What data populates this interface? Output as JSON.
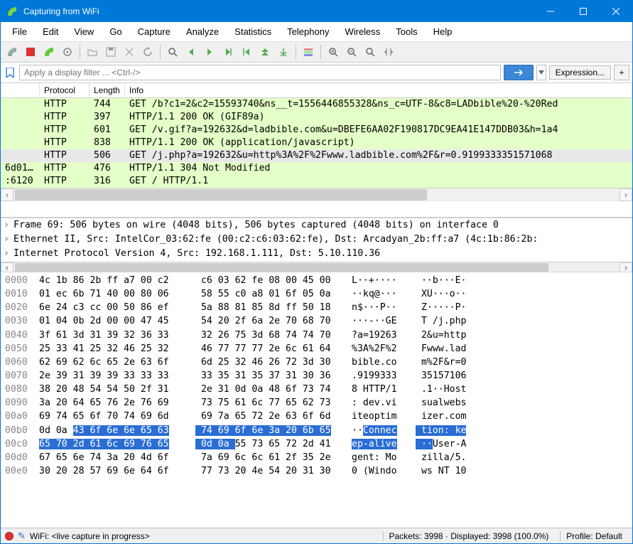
{
  "window": {
    "title": "Capturing from WiFi"
  },
  "menu": [
    "File",
    "Edit",
    "View",
    "Go",
    "Capture",
    "Analyze",
    "Statistics",
    "Telephony",
    "Wireless",
    "Tools",
    "Help"
  ],
  "filter": {
    "placeholder": "Apply a display filter ... <Ctrl-/>",
    "expression": "Expression...",
    "plus": "+"
  },
  "packet_list": {
    "headers": {
      "protocol": "Protocol",
      "length": "Length",
      "info": "Info"
    },
    "rows": [
      {
        "addr": "",
        "proto": "HTTP",
        "len": "744",
        "info": "GET /b?c1=2&c2=15593740&ns__t=1556446855328&ns_c=UTF-8&c8=LADbible%20-%20Red",
        "cls": "green"
      },
      {
        "addr": "",
        "proto": "HTTP",
        "len": "397",
        "info": "HTTP/1.1 200 OK  (GIF89a)",
        "cls": "green"
      },
      {
        "addr": "",
        "proto": "HTTP",
        "len": "601",
        "info": "GET /v.gif?a=192632&d=ladbible.com&u=DBEFE6AA02F190817DC9EA41E147DDB03&h=1a4",
        "cls": "green"
      },
      {
        "addr": "",
        "proto": "HTTP",
        "len": "838",
        "info": "HTTP/1.1 200 OK  (application/javascript)",
        "cls": "green"
      },
      {
        "addr": "",
        "proto": "HTTP",
        "len": "506",
        "info": "GET /j.php?a=192632&u=http%3A%2F%2Fwww.ladbible.com%2F&r=0.9199333351571068",
        "cls": "selected"
      },
      {
        "addr": "6d01…",
        "proto": "HTTP",
        "len": "476",
        "info": "HTTP/1.1 304 Not Modified",
        "cls": "green"
      },
      {
        "addr": ":6120",
        "proto": "HTTP",
        "len": "316",
        "info": "GET / HTTP/1.1",
        "cls": "green"
      }
    ]
  },
  "details": [
    "Frame 69: 506 bytes on wire (4048 bits), 506 bytes captured (4048 bits) on interface 0",
    "Ethernet II, Src: IntelCor_03:62:fe (00:c2:c6:03:62:fe), Dst: Arcadyan_2b:ff:a7 (4c:1b:86:2b:",
    "Internet Protocol Version 4, Src: 192.168.1.111, Dst: 5.10.110.36"
  ],
  "hex": [
    {
      "off": "0000",
      "b1": "4c 1b 86 2b ff a7 00 c2",
      "b2": " c6 03 62 fe 08 00 45 00",
      "a1": "L··+····",
      "a2": " ··b···E·"
    },
    {
      "off": "0010",
      "b1": "01 ec 6b 71 40 00 80 06",
      "b2": " 58 55 c0 a8 01 6f 05 0a",
      "a1": "··kq@···",
      "a2": " XU···o··"
    },
    {
      "off": "0020",
      "b1": "6e 24 c3 cc 00 50 86 ef",
      "b2": " 5a 88 81 85 8d ff 50 18",
      "a1": "n$···P··",
      "a2": " Z·····P·"
    },
    {
      "off": "0030",
      "b1": "01 04 0b 2d 00 00 47 45",
      "b2": " 54 20 2f 6a 2e 70 68 70",
      "a1": "···-··GE",
      "a2": " T /j.php"
    },
    {
      "off": "0040",
      "b1": "3f 61 3d 31 39 32 36 33",
      "b2": " 32 26 75 3d 68 74 74 70",
      "a1": "?a=19263",
      "a2": " 2&u=http"
    },
    {
      "off": "0050",
      "b1": "25 33 41 25 32 46 25 32",
      "b2": " 46 77 77 77 2e 6c 61 64",
      "a1": "%3A%2F%2",
      "a2": " Fwww.lad"
    },
    {
      "off": "0060",
      "b1": "62 69 62 6c 65 2e 63 6f",
      "b2": " 6d 25 32 46 26 72 3d 30",
      "a1": "bible.co",
      "a2": " m%2F&r=0"
    },
    {
      "off": "0070",
      "b1": "2e 39 31 39 39 33 33 33",
      "b2": " 33 35 31 35 37 31 30 36",
      "a1": ".9199333",
      "a2": " 35157106"
    },
    {
      "off": "0080",
      "b1": "38 20 48 54 54 50 2f 31",
      "b2": " 2e 31 0d 0a 48 6f 73 74",
      "a1": "8 HTTP/1",
      "a2": " .1··Host"
    },
    {
      "off": "0090",
      "b1": "3a 20 64 65 76 2e 76 69",
      "b2": " 73 75 61 6c 77 65 62 73",
      "a1": ": dev.vi",
      "a2": " sualwebs"
    },
    {
      "off": "00a0",
      "b1": "69 74 65 6f 70 74 69 6d",
      "b2": " 69 7a 65 72 2e 63 6f 6d",
      "a1": "iteoptim",
      "a2": " izer.com"
    },
    {
      "off": "00b0",
      "b1": "0d 0a ",
      "b1hl": "43 6f 6e 6e 65 63",
      "b2hl": " 74 69 6f 6e 3a 20 6b 65",
      "a1": "··",
      "a1hl": "Connec",
      "a2hl": " tion: ke"
    },
    {
      "off": "00c0",
      "b1hl": "65 70 2d 61 6c 69 76 65",
      "b2hl": " 0d 0a ",
      "b2": "55 73 65 72 2d 41",
      "a1hl": "ep-alive",
      "a2hl": " ··",
      "a2": "User-A"
    },
    {
      "off": "00d0",
      "b1": "67 65 6e 74 3a 20 4d 6f",
      "b2": " 7a 69 6c 6c 61 2f 35 2e",
      "a1": "gent: Mo",
      "a2": " zilla/5."
    },
    {
      "off": "00e0",
      "b1": "30 20 28 57 69 6e 64 6f",
      "b2": " 77 73 20 4e 54 20 31 30",
      "a1": "0 (Windo",
      "a2": " ws NT 10"
    }
  ],
  "status": {
    "left": "WiFi: <live capture in progress>",
    "packets": "Packets: 3998 · Displayed: 3998 (100.0%)",
    "profile": "Profile: Default"
  }
}
